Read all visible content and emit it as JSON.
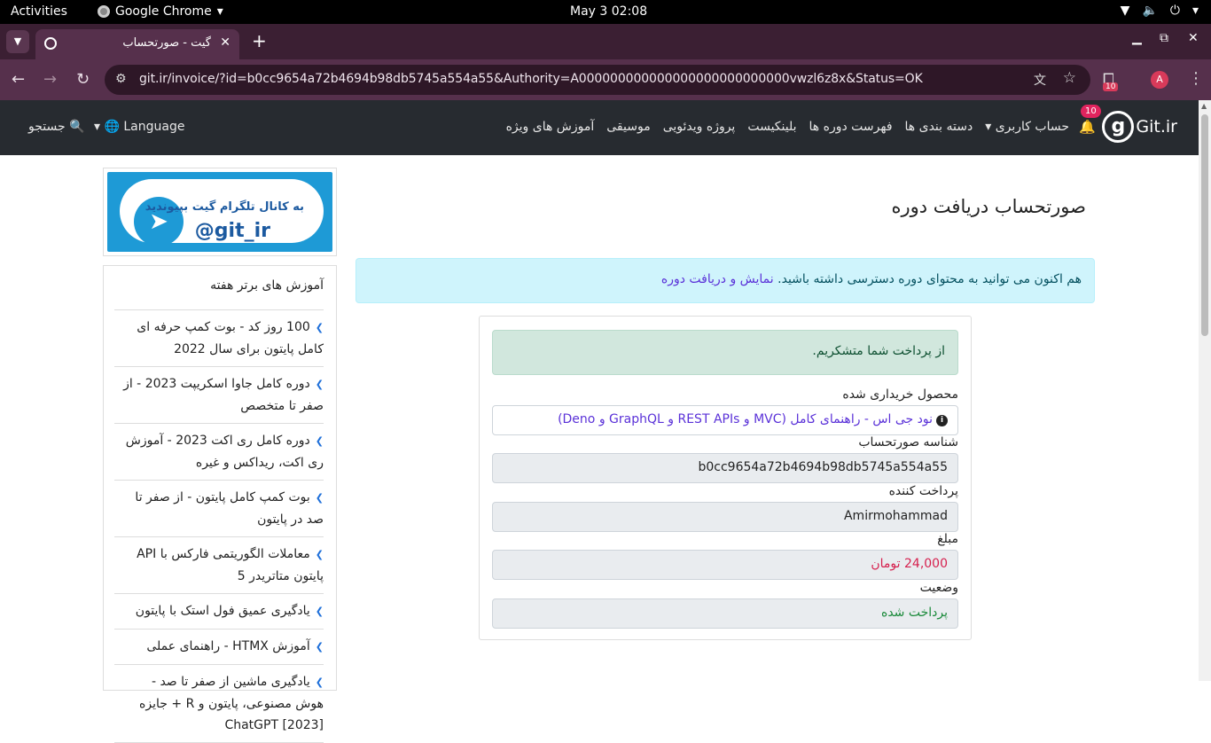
{
  "os": {
    "activities": "Activities",
    "app_name": "Google Chrome",
    "clock": "May 3  02:08"
  },
  "browser": {
    "tab_title": "گیت - صورتحساب",
    "url": "git.ir/invoice/?id=b0cc9654a72b4694b98db5745a554a55&Authority=A000000000000000000000000000vwzl6z8x&Status=OK",
    "extension_badge": "10",
    "profile_initial": "A"
  },
  "site_nav": {
    "logo_text": "Git.ir",
    "notification_count": "10",
    "menu": [
      "حساب کاربری",
      "دسته بندی ها",
      "فهرست دوره ها",
      "بلینکیست",
      "پروژه ویدئویی",
      "موسیقی",
      "آموزش های ویژه"
    ],
    "language": "Language",
    "search": "جستجو"
  },
  "sidebar": {
    "banner_line1": "به کانال تلگرام گیت بپیوندید",
    "banner_line2": "@git_ir",
    "top_title": "آموزش های برتر هفته",
    "top_items": [
      "100 روز کد - بوت کمپ حرفه ای کامل پایتون برای سال 2022",
      "دوره کامل جاوا اسکریپت 2023 - از صفر تا متخصص",
      "دوره کامل ری اکت 2023 - آموزش ری اکت، ریداکس و غیره",
      "بوت کمپ کامل پایتون - از صفر تا صد در پایتون",
      "معاملات الگوریتمی فارکس با API پایتون متاتریدر 5",
      "یادگیری عمیق فول استک با پایتون",
      "آموزش HTMX - راهنمای عملی",
      "یادگیری ماشین از صفر تا صد - هوش مصنوعی، پایتون و R + جایزه ChatGPT [2023]"
    ]
  },
  "main": {
    "title": "صورتحساب دریافت دوره",
    "info_text": "هم اکنون می توانید به محتوای دوره دسترسی داشته باشید.",
    "info_link": "نمایش و دریافت دوره",
    "success_text": "از پرداخت شما متشکریم.",
    "product_label": "محصول خریداری شده",
    "product_value": "نود جی اس - راهنمای کامل (MVC و REST APIs و GraphQL و Deno)",
    "invoice_id_label": "شناسه صورتحساب",
    "invoice_id_value": "b0cc9654a72b4694b98db5745a554a55",
    "payer_label": "پرداخت کننده",
    "payer_value": "Amirmohammad",
    "amount_label": "مبلغ",
    "amount_value": "24,000 تومان",
    "status_label": "وضعیت",
    "status_value": "پرداخت شده"
  }
}
